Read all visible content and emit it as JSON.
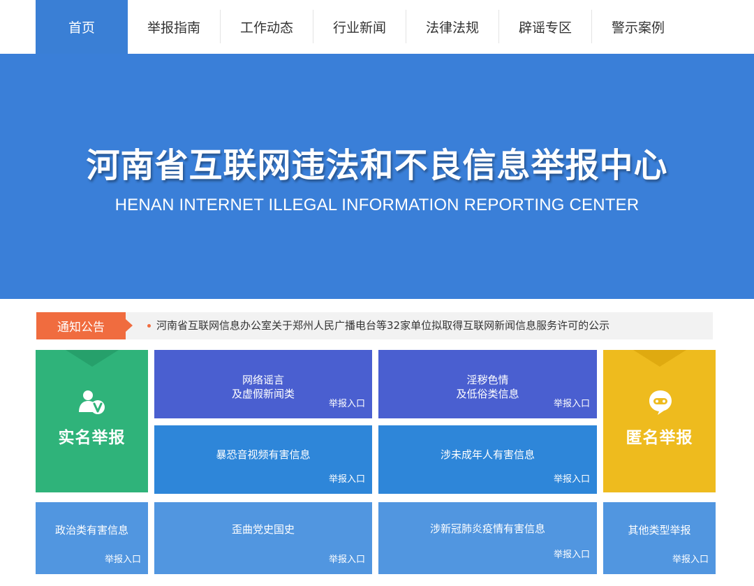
{
  "nav": {
    "items": [
      {
        "label": "首页"
      },
      {
        "label": "举报指南"
      },
      {
        "label": "工作动态"
      },
      {
        "label": "行业新闻"
      },
      {
        "label": "法律法规"
      },
      {
        "label": "辟谣专区"
      },
      {
        "label": "警示案例"
      }
    ],
    "active_index": 0
  },
  "banner": {
    "title": "河南省互联网违法和不良信息举报中心",
    "subtitle": "HENAN INTERNET ILLEGAL INFORMATION REPORTING CENTER"
  },
  "notice": {
    "tag": "通知公告",
    "text": "河南省互联网信息办公室关于郑州人民广播电台等32家单位拟取得互联网新闻信息服务许可的公示"
  },
  "realname": {
    "label": "实名举报",
    "icon": "user-verified-icon"
  },
  "anonymous": {
    "label": "匿名举报",
    "icon": "chat-bubble-icon"
  },
  "entry_label": "举报入口",
  "categories": {
    "rumor": {
      "line1": "网络谣言",
      "line2": "及虚假新闻类"
    },
    "porn": {
      "line1": "淫秽色情",
      "line2": "及低俗类信息"
    },
    "violence": {
      "line1": "暴恐音视频有害信息"
    },
    "minor": {
      "line1": "涉未成年人有害信息"
    },
    "political": {
      "line1": "政治类有害信息"
    },
    "history": {
      "line1": "歪曲党史国史"
    },
    "covid": {
      "line1": "涉新冠肺炎疫情有害信息"
    },
    "other": {
      "line1": "其他类型举报"
    }
  },
  "colors": {
    "nav_active": "#3a7fd5",
    "banner": "#3a7fd8",
    "notice_tag": "#f06c3f",
    "realname_tile": "#2fb37a",
    "anonymous_tile": "#eebb1e",
    "tile_dark_blue": "#4a5fd0",
    "tile_mid_blue": "#2e86d9",
    "tile_light_blue": "#5196e0"
  }
}
